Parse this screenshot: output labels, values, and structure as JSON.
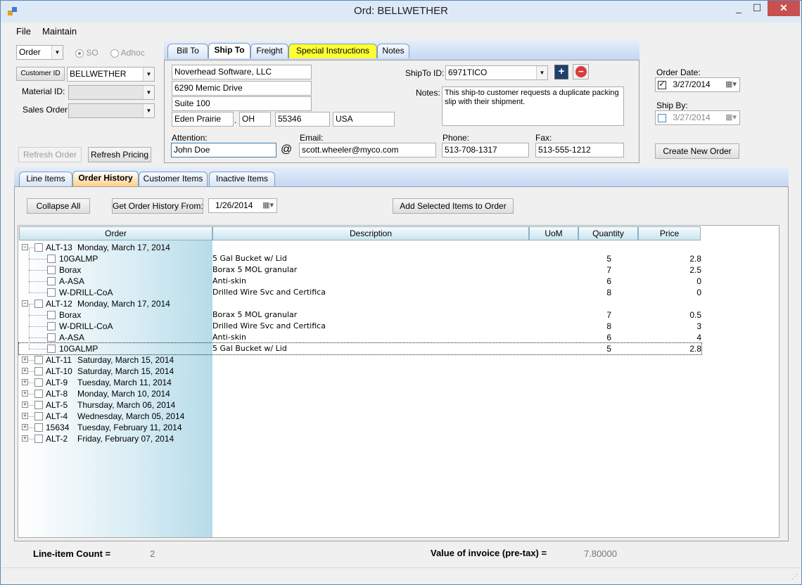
{
  "window": {
    "title": "Ord: BELLWETHER",
    "min": "_",
    "max": "☐",
    "close": "✕"
  },
  "menu": {
    "file": "File",
    "maintain": "Maintain"
  },
  "order_type": {
    "value": "Order",
    "so_label": "SO",
    "adhoc_label": "Adhoc"
  },
  "customer": {
    "button": "Customer ID",
    "value": "BELLWETHER"
  },
  "material": {
    "label": "Material ID:",
    "value": ""
  },
  "sales_order": {
    "label": "Sales Order:",
    "value": ""
  },
  "buttons": {
    "refresh_order": "Refresh Order",
    "refresh_pricing": "Refresh Pricing",
    "create_new_order": "Create New Order"
  },
  "address_tabs": [
    "Bill To",
    "Ship To",
    "Freight",
    "Special Instructions",
    "Notes"
  ],
  "ship_to": {
    "name": "Noverhead Software, LLC",
    "address1": "6290 Memic Drive",
    "address2": "Suite 100",
    "city": "Eden Prairie",
    "state": "OH",
    "zip": "55346",
    "country": "USA",
    "shipto_id_label": "ShipTo ID:",
    "shipto_id": "6971TICO",
    "notes_label": "Notes:",
    "notes": "This ship-to customer requests a duplicate packing slip with their shipment.",
    "attention_label": "Attention:",
    "attention": "John Doe",
    "at_sign": "@",
    "email_label": "Email:",
    "email": "scott.wheeler@myco.com",
    "phone_label": "Phone:",
    "phone": "513-708-1317",
    "fax_label": "Fax:",
    "fax": "513-555-1212",
    "add_icon": "+",
    "remove_icon": "−"
  },
  "dates": {
    "order_date_label": "Order Date:",
    "order_date": "3/27/2014",
    "ship_by_label": "Ship By:",
    "ship_by": "3/27/2014"
  },
  "lower_tabs": [
    "Line Items",
    "Order History",
    "Customer Items",
    "Inactive Items"
  ],
  "history": {
    "collapse_all": "Collapse All",
    "get_from_label": "Get Order History From:",
    "from_date": "1/26/2014",
    "add_selected": "Add Selected Items to Order",
    "columns": [
      "Order",
      "Description",
      "UoM",
      "Quantity",
      "Price"
    ],
    "rows": [
      {
        "kind": "group",
        "expanded": true,
        "order": "ALT-13",
        "date": "Monday, March 17, 2014"
      },
      {
        "kind": "item",
        "item": "10GALMP",
        "description": "5 Gal Bucket w/ Lid",
        "qty": "5",
        "price": "2.8"
      },
      {
        "kind": "item",
        "item": "Borax",
        "description": "Borax 5 MOL granular",
        "qty": "7",
        "price": "2.5"
      },
      {
        "kind": "item",
        "item": "A-ASA",
        "description": "Anti-skin",
        "qty": "6",
        "price": "0"
      },
      {
        "kind": "item",
        "item": "W-DRILL-CoA",
        "description": "Drilled Wire Svc and Certifica",
        "qty": "8",
        "price": "0"
      },
      {
        "kind": "group",
        "expanded": true,
        "order": "ALT-12",
        "date": "Monday, March 17, 2014"
      },
      {
        "kind": "item",
        "item": "Borax",
        "description": "Borax 5 MOL granular",
        "qty": "7",
        "price": "0.5"
      },
      {
        "kind": "item",
        "item": "W-DRILL-CoA",
        "description": "Drilled Wire Svc and Certifica",
        "qty": "8",
        "price": "3"
      },
      {
        "kind": "item",
        "item": "A-ASA",
        "description": "Anti-skin",
        "qty": "6",
        "price": "4"
      },
      {
        "kind": "item",
        "item": "10GALMP",
        "description": "5 Gal Bucket w/ Lid",
        "qty": "5",
        "price": "2.8",
        "focused": true
      },
      {
        "kind": "group",
        "expanded": false,
        "order": "ALT-11",
        "date": "Saturday, March 15, 2014"
      },
      {
        "kind": "group",
        "expanded": false,
        "order": "ALT-10",
        "date": "Saturday, March 15, 2014"
      },
      {
        "kind": "group",
        "expanded": false,
        "order": "ALT-9",
        "date": "Tuesday, March 11, 2014"
      },
      {
        "kind": "group",
        "expanded": false,
        "order": "ALT-8",
        "date": "Monday, March 10, 2014"
      },
      {
        "kind": "group",
        "expanded": false,
        "order": "ALT-5",
        "date": "Thursday, March 06, 2014"
      },
      {
        "kind": "group",
        "expanded": false,
        "order": "ALT-4",
        "date": "Wednesday, March 05, 2014"
      },
      {
        "kind": "group",
        "expanded": false,
        "order": "15634",
        "date": "Tuesday, February 11, 2014"
      },
      {
        "kind": "group",
        "expanded": false,
        "order": "ALT-2",
        "date": "Friday, February 07, 2014"
      }
    ]
  },
  "footer": {
    "line_count_label": "Line-item Count =",
    "line_count": "2",
    "invoice_label": "Value of invoice (pre-tax) =",
    "invoice_value": "7.80000"
  },
  "colors": {
    "special_tab": "#ffff33",
    "active_tab_accent": "#ffd08a",
    "tree_gradient_end": "#b6dbe9"
  }
}
